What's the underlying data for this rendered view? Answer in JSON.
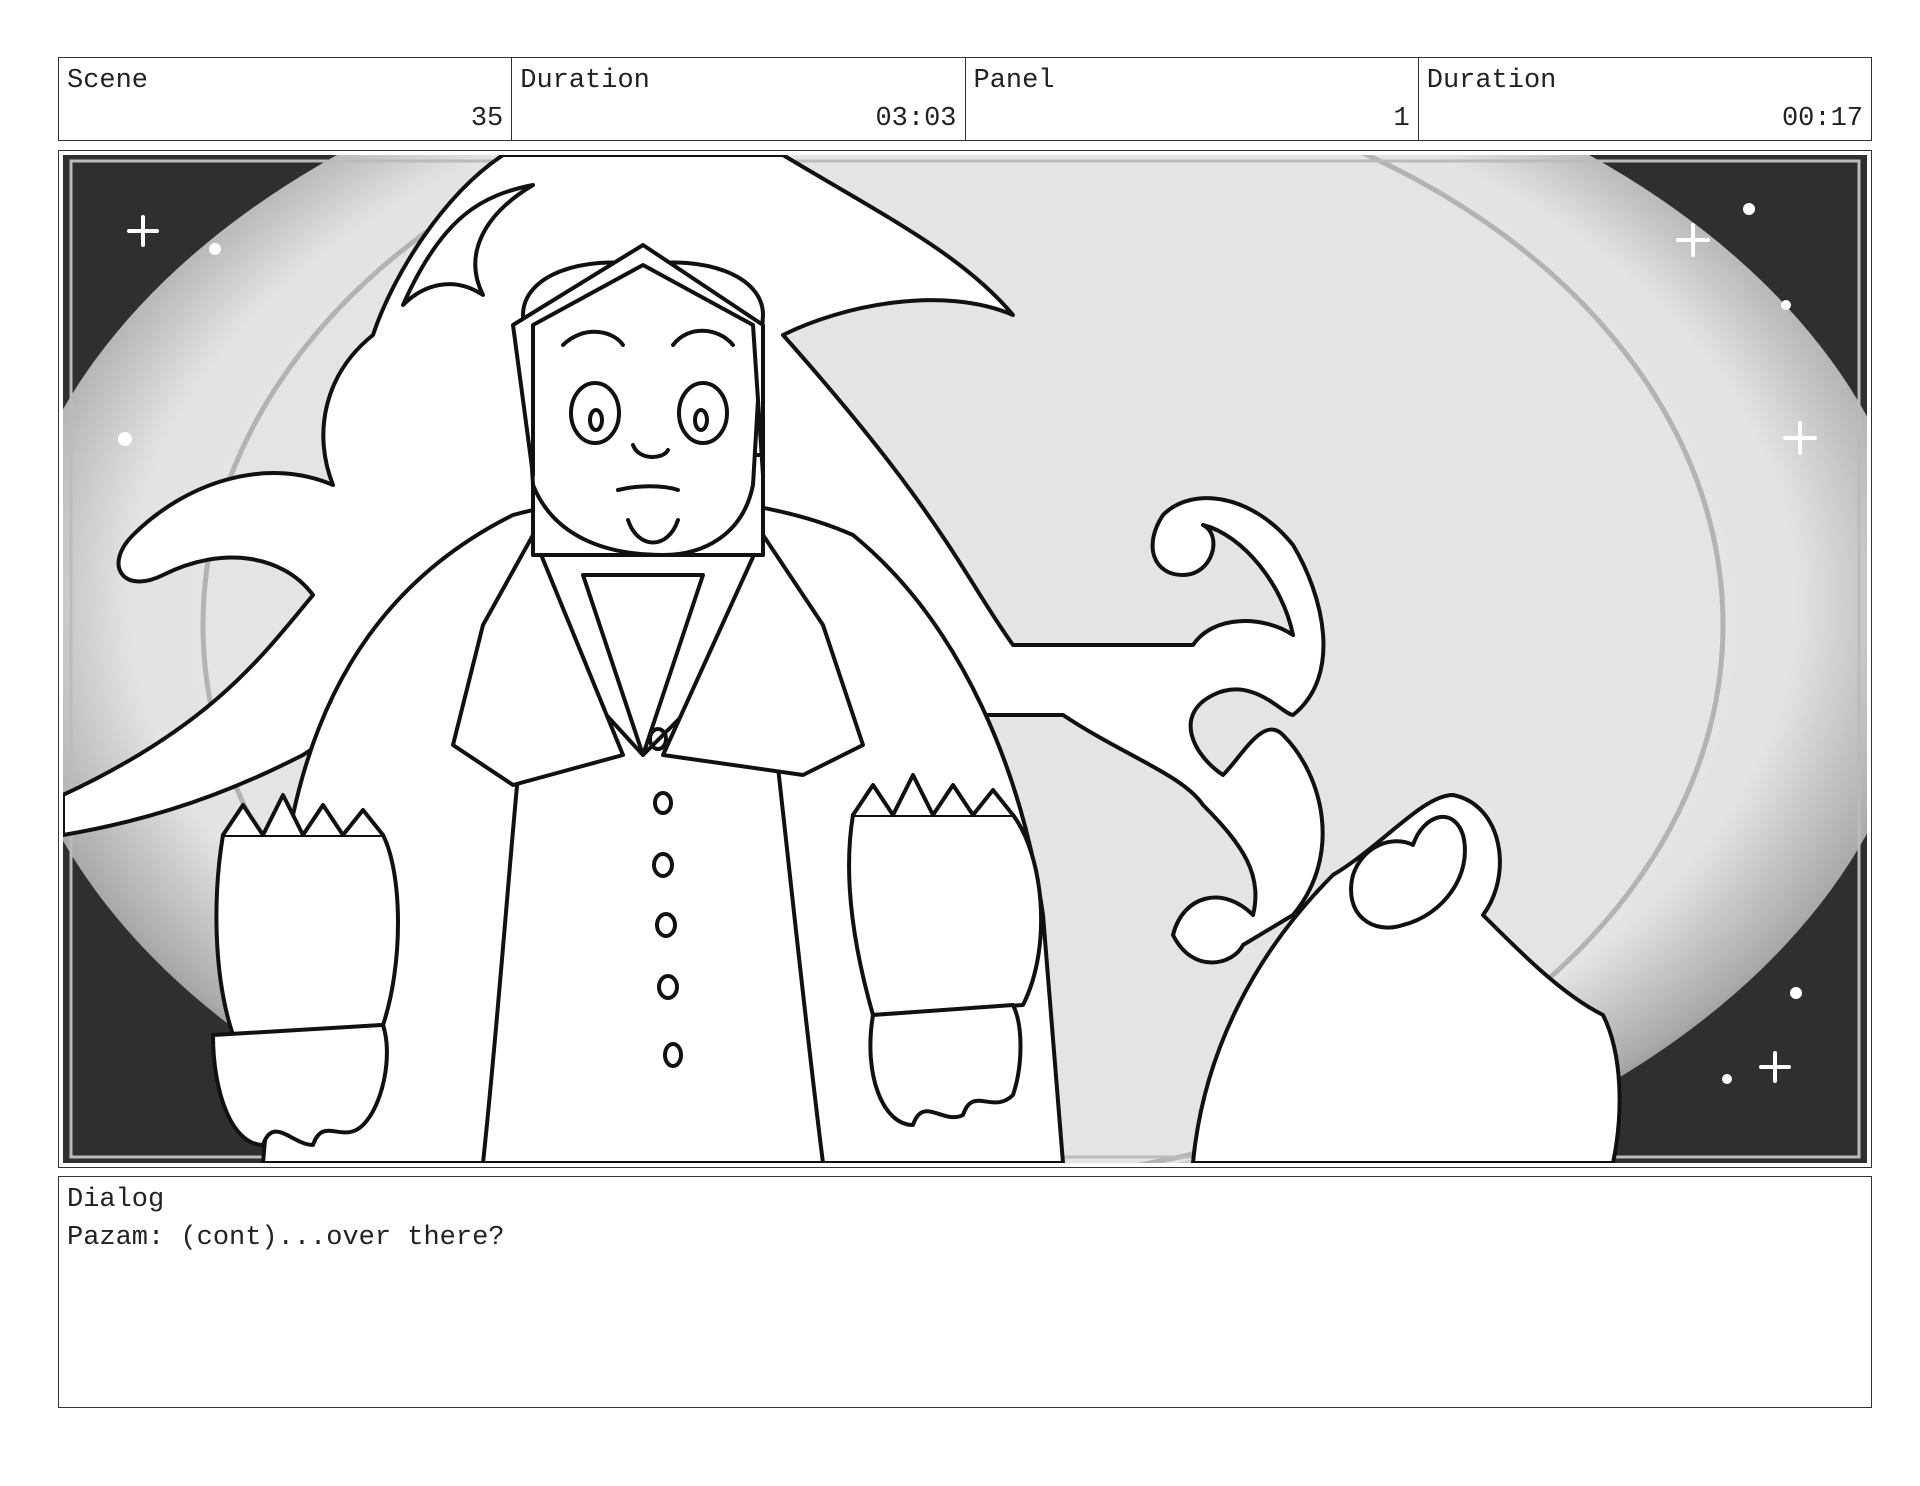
{
  "header": {
    "scene_label": "Scene",
    "scene_value": "35",
    "duration_label": "Duration",
    "duration_value": "03:03",
    "panel_label": "Panel",
    "panel_value": "1",
    "panel_duration_label": "Duration",
    "panel_duration_value": "00:17"
  },
  "dialog": {
    "label": "Dialog",
    "text": "Pazam: (cont)...over there?"
  }
}
